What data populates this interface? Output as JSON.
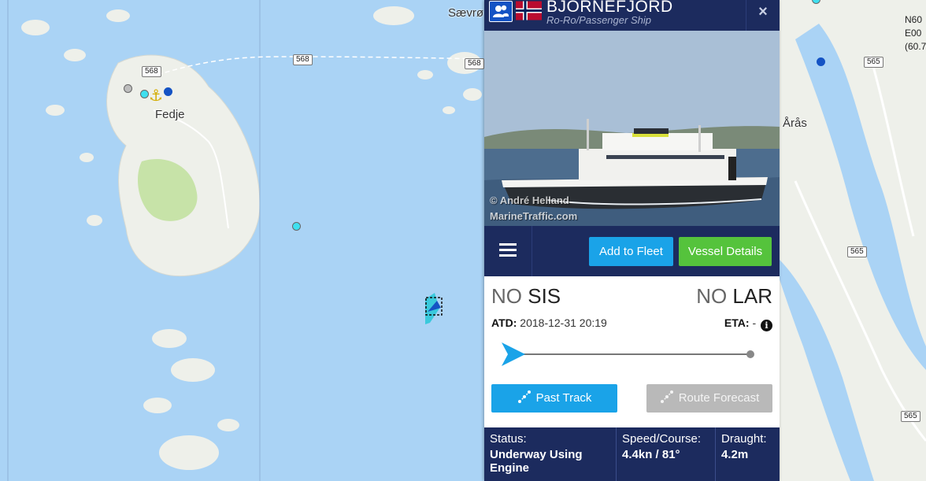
{
  "map": {
    "road_badges": [
      "568",
      "568",
      "568",
      "565",
      "565",
      "565"
    ],
    "places": {
      "fedje": "Fedje",
      "saevroy": "Sævrø",
      "aras": "Årås"
    },
    "coords": [
      "N60",
      "E00",
      "(60.7"
    ]
  },
  "vessel": {
    "name": "BJORNEFJORD",
    "type": "Ro-Ro/Passenger Ship",
    "flag": "Norway",
    "close_label": "×",
    "photo_credit_line1": "© André Helland",
    "photo_credit_line2": "MarineTraffic.com"
  },
  "toolbar": {
    "add_to_fleet": "Add to Fleet",
    "vessel_details": "Vessel Details"
  },
  "voyage": {
    "from_country": "NO",
    "from_port": "SIS",
    "to_country": "NO",
    "to_port": "LAR",
    "atd_label": "ATD:",
    "atd_value": "2018-12-31 20:19",
    "eta_label": "ETA:",
    "eta_value": "-",
    "progress": 0.0,
    "past_track": "Past Track",
    "route_forecast": "Route Forecast"
  },
  "status": {
    "status_label": "Status:",
    "status_value": "Underway Using Engine",
    "speed_label": "Speed/Course:",
    "speed_value": "4.4kn / 81°",
    "draught_label": "Draught:",
    "draught_value": "4.2m"
  },
  "colors": {
    "header_navy": "#1c2b5e",
    "blue_button": "#1aa3e8",
    "green_button": "#55c33c",
    "grey_button": "#b9b9b9",
    "sea": "#aad3f5"
  }
}
